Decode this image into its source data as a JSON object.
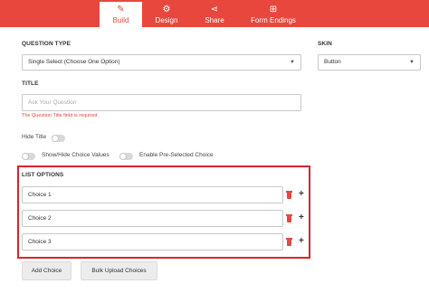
{
  "nav": {
    "tabs": [
      {
        "label": "Build",
        "icon": "edit-icon",
        "active": true
      },
      {
        "label": "Design",
        "icon": "gear-icon",
        "active": false
      },
      {
        "label": "Share",
        "icon": "share-icon",
        "active": false
      },
      {
        "label": "Form Endings",
        "icon": "sitemap-icon",
        "active": false
      }
    ]
  },
  "question_type": {
    "label": "QUESTION TYPE",
    "value": "Single Select (Choose One Option)"
  },
  "skin": {
    "label": "SKIN",
    "value": "Button"
  },
  "title": {
    "label": "TITLE",
    "placeholder": "Ask Your Question",
    "error": "The Question Title field is required."
  },
  "toggles": {
    "hide_title": "Hide Title",
    "show_hide_choice_values": "Show/Hide Choice Values",
    "enable_preselected": "Enable Pre-Selected Choice"
  },
  "list_options": {
    "label": "LIST OPTIONS",
    "choices": [
      "Choice 1",
      "Choice 2",
      "Choice 3"
    ]
  },
  "buttons": {
    "add_choice": "Add Choice",
    "bulk_upload": "Bulk Upload Choices"
  },
  "colors": {
    "accent": "#e8473d",
    "highlight_border": "#d9232e"
  }
}
